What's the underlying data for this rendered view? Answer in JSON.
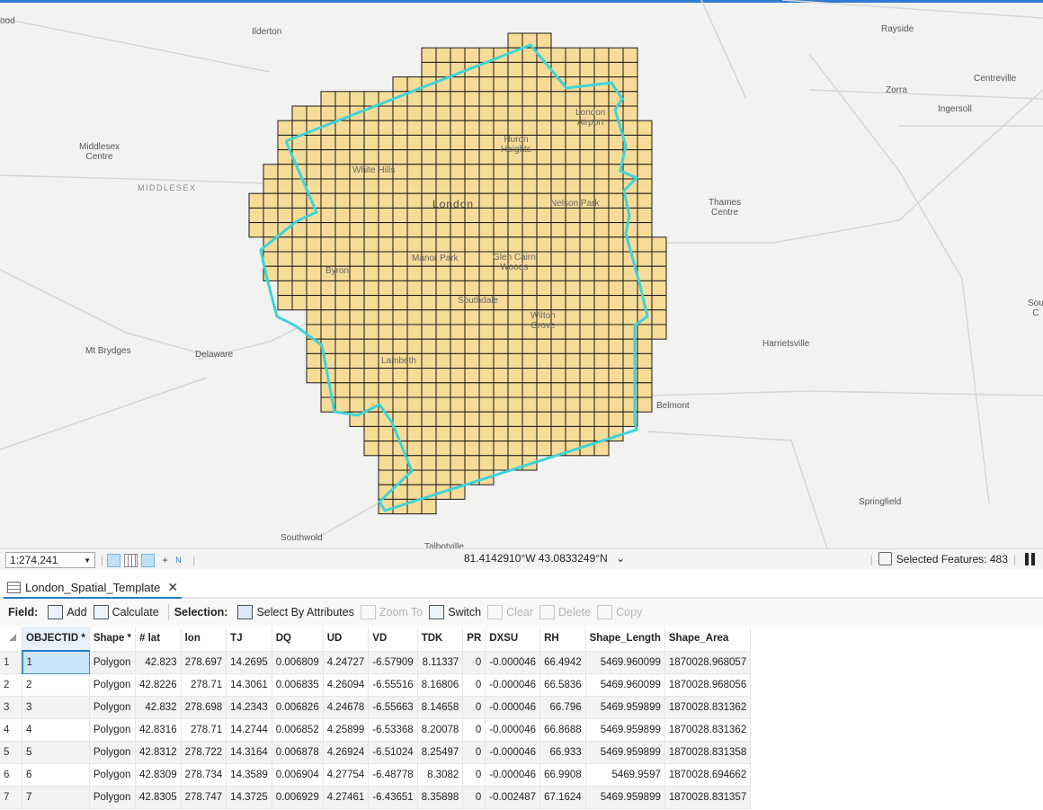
{
  "map": {
    "places": [
      {
        "name": "Ilderton",
        "cls": ""
      },
      {
        "name": "Rayside",
        "cls": ""
      },
      {
        "name": "Zorra",
        "cls": ""
      },
      {
        "name": "Centreville",
        "cls": ""
      },
      {
        "name": "Ingersoll",
        "cls": ""
      },
      {
        "name": "Middlesex\nCentre",
        "cls": ""
      },
      {
        "name": "MIDDLESEX",
        "cls": "region"
      },
      {
        "name": "White Hills",
        "cls": "over"
      },
      {
        "name": "London",
        "cls": "big"
      },
      {
        "name": "Nelson Park",
        "cls": "over"
      },
      {
        "name": "Huron\nHeights",
        "cls": "over"
      },
      {
        "name": "London\nAirport",
        "cls": "over"
      },
      {
        "name": "Thames\nCentre",
        "cls": ""
      },
      {
        "name": "Byron",
        "cls": "over"
      },
      {
        "name": "Manor Park",
        "cls": "over"
      },
      {
        "name": "Glen Cairn\nWoods",
        "cls": "over"
      },
      {
        "name": "Southdale",
        "cls": "over"
      },
      {
        "name": "Wilton\nGrove",
        "cls": "over"
      },
      {
        "name": "Harrietsville",
        "cls": ""
      },
      {
        "name": "Mt Brydges",
        "cls": ""
      },
      {
        "name": "Delaware",
        "cls": ""
      },
      {
        "name": "Lambeth",
        "cls": "over"
      },
      {
        "name": "Belmont",
        "cls": ""
      },
      {
        "name": "Springfield",
        "cls": ""
      },
      {
        "name": "Southwold",
        "cls": ""
      },
      {
        "name": "Talbotville",
        "cls": ""
      },
      {
        "name": "ood",
        "cls": ""
      },
      {
        "name": "Sou\nC",
        "cls": ""
      }
    ],
    "colors": {
      "grid_fill": "#f6dc98",
      "grid_stroke": "#1a1a1a",
      "boundary": "#3fd3d8",
      "background": "#f2f2f1"
    }
  },
  "statusbar": {
    "scale": "1:274,241",
    "coordinates": "81.4142910°W 43.0833249°N",
    "selected_features": "Selected Features: 483"
  },
  "tab": {
    "title": "London_Spatial_Template"
  },
  "toolbar": {
    "field_label": "Field:",
    "add": "Add",
    "calculate": "Calculate",
    "selection_label": "Selection:",
    "select_by_attributes": "Select By Attributes",
    "zoom_to": "Zoom To",
    "switch": "Switch",
    "clear": "Clear",
    "delete": "Delete",
    "copy": "Copy"
  },
  "table": {
    "columns": [
      "OBJECTID *",
      "Shape *",
      "# lat",
      "lon",
      "TJ",
      "DQ",
      "UD",
      "VD",
      "TDK",
      "PR",
      "DXSU",
      "RH",
      "Shape_Length",
      "Shape_Area"
    ],
    "rows": [
      [
        "1",
        "1",
        "Polygon",
        "42.823",
        "278.697",
        "14.2695",
        "0.006809",
        "4.24727",
        "-6.57909",
        "8.11337",
        "0",
        "-0.000046",
        "66.4942",
        "5469.960099",
        "1870028.968057"
      ],
      [
        "2",
        "2",
        "Polygon",
        "42.8226",
        "278.71",
        "14.3061",
        "0.006835",
        "4.26094",
        "-6.55516",
        "8.16806",
        "0",
        "-0.000046",
        "66.5836",
        "5469.960099",
        "1870028.968056"
      ],
      [
        "3",
        "3",
        "Polygon",
        "42.832",
        "278.698",
        "14.2343",
        "0.006826",
        "4.24678",
        "-6.55663",
        "8.14658",
        "0",
        "-0.000046",
        "66.796",
        "5469.959899",
        "1870028.831362"
      ],
      [
        "4",
        "4",
        "Polygon",
        "42.8316",
        "278.71",
        "14.2744",
        "0.006852",
        "4.25899",
        "-6.53368",
        "8.20078",
        "0",
        "-0.000046",
        "66.8688",
        "5469.959899",
        "1870028.831362"
      ],
      [
        "5",
        "5",
        "Polygon",
        "42.8312",
        "278.722",
        "14.3164",
        "0.006878",
        "4.26924",
        "-6.51024",
        "8.25497",
        "0",
        "-0.000046",
        "66.933",
        "5469.959899",
        "1870028.831358"
      ],
      [
        "6",
        "6",
        "Polygon",
        "42.8309",
        "278.734",
        "14.3589",
        "0.006904",
        "4.27754",
        "-6.48778",
        "8.3082",
        "0",
        "-0.000046",
        "66.9908",
        "5469.9597",
        "1870028.694662"
      ],
      [
        "7",
        "7",
        "Polygon",
        "42.8305",
        "278.747",
        "14.3725",
        "0.006929",
        "4.27461",
        "-6.43651",
        "8.35898",
        "0",
        "-0.002487",
        "67.1624",
        "5469.959899",
        "1870028.831357"
      ]
    ]
  }
}
